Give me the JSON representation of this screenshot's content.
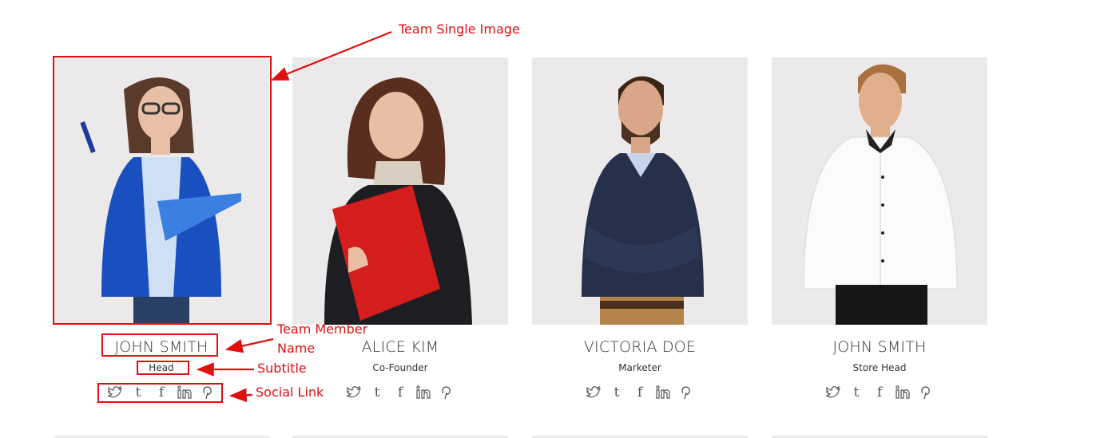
{
  "team": [
    {
      "name": "JOHN SMITH",
      "role": "Head"
    },
    {
      "name": "ALICE KIM",
      "role": "Co-Founder"
    },
    {
      "name": "VICTORIA DOE",
      "role": "Marketer"
    },
    {
      "name": "JOHN SMITH",
      "role": "Store Head"
    }
  ],
  "social_icons": [
    "twitter-icon",
    "tumblr-icon",
    "facebook-icon",
    "linkedin-icon",
    "pinterest-icon"
  ],
  "annotations": {
    "image": "Team Single Image",
    "name_line1": "Team Member",
    "name_line2": "Name",
    "subtitle": "Subtitle",
    "social": "Social Link"
  },
  "colors": {
    "annotation": "#e01010",
    "photo_bg": "#ece9ea",
    "text": "#333333"
  }
}
